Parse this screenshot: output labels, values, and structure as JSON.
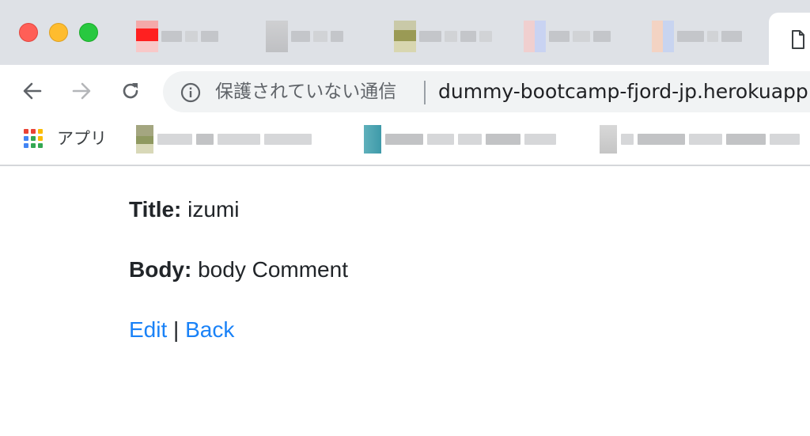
{
  "browser": {
    "window_controls": [
      "close",
      "minimize",
      "zoom"
    ],
    "active_tab_icon": "document-icon",
    "security_label": "保護されていない通信",
    "url": "dummy-bootcamp-fjord-jp.herokuapp",
    "bookmarks": {
      "apps_label": "アプリ"
    }
  },
  "page": {
    "title_label": "Title:",
    "title_value": "izumi",
    "body_label": "Body:",
    "body_value": "body Comment",
    "edit_link": "Edit",
    "separator": "|",
    "back_link": "Back"
  },
  "colors": {
    "link": "#1a82f7",
    "text": "#212529",
    "tabstrip": "#dee1e6",
    "omnibox": "#f1f3f4"
  }
}
